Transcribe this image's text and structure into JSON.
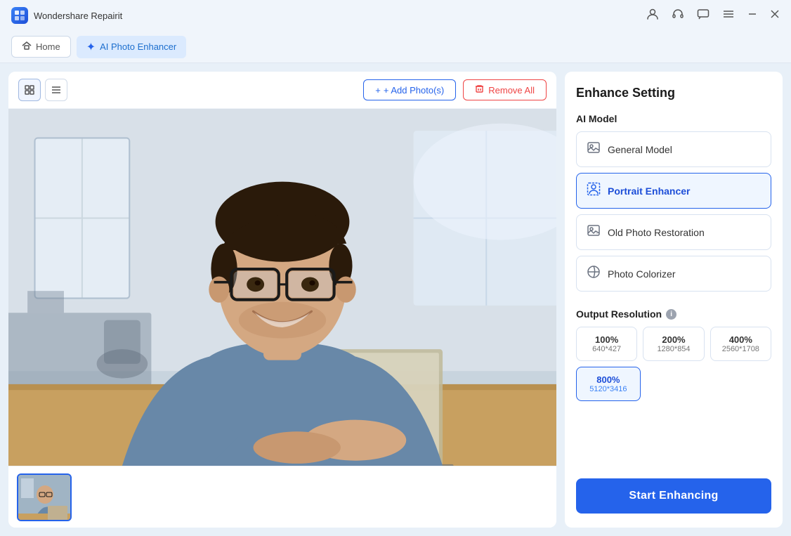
{
  "titlebar": {
    "app_name": "Wondershare Repairit",
    "app_icon": "W"
  },
  "navbar": {
    "home_label": "Home",
    "active_tab_label": "AI Photo Enhancer",
    "active_tab_icon": "✦"
  },
  "toolbar": {
    "add_photos_label": "+ Add Photo(s)",
    "remove_all_label": "Remove All"
  },
  "right_panel": {
    "title": "Enhance Setting",
    "ai_model_label": "AI Model",
    "models": [
      {
        "id": "general",
        "label": "General Model",
        "icon": "🖼",
        "selected": false
      },
      {
        "id": "portrait",
        "label": "Portrait Enhancer",
        "icon": "👤",
        "selected": true
      },
      {
        "id": "old_photo",
        "label": "Old Photo Restoration",
        "icon": "🖼",
        "selected": false
      },
      {
        "id": "colorizer",
        "label": "Photo Colorizer",
        "icon": "🎨",
        "selected": false
      }
    ],
    "output_resolution_label": "Output Resolution",
    "resolutions": [
      {
        "id": "100",
        "pct": "100%",
        "dim": "640*427",
        "selected": false
      },
      {
        "id": "200",
        "pct": "200%",
        "dim": "1280*854",
        "selected": false
      },
      {
        "id": "400",
        "pct": "400%",
        "dim": "2560*1708",
        "selected": false
      },
      {
        "id": "800",
        "pct": "800%",
        "dim": "5120*3416",
        "selected": true
      }
    ],
    "start_btn_label": "Start Enhancing"
  }
}
